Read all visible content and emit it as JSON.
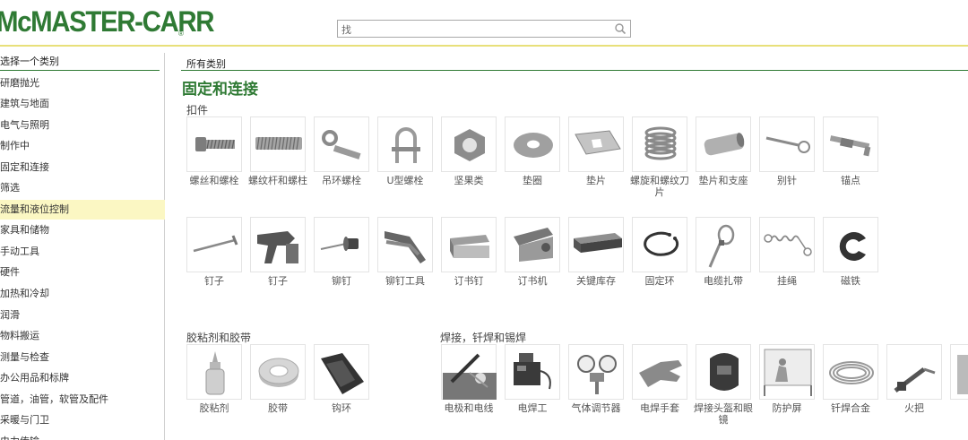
{
  "header": {
    "logo_text": "McMASTER-CARR",
    "logo_reg": "®",
    "search_value": "找"
  },
  "sidebar": {
    "title": "选择一个类别",
    "items": [
      {
        "label": "研磨抛光"
      },
      {
        "label": "建筑与地面"
      },
      {
        "label": "电气与照明"
      },
      {
        "label": "制作中"
      },
      {
        "label": "固定和连接"
      },
      {
        "label": "筛选"
      },
      {
        "label": "流量和液位控制",
        "active": true
      },
      {
        "label": "家具和储物"
      },
      {
        "label": "手动工具"
      },
      {
        "label": "硬件"
      },
      {
        "label": "加热和冷却"
      },
      {
        "label": "润滑"
      },
      {
        "label": "物料搬运"
      },
      {
        "label": "测量与检查"
      },
      {
        "label": "办公用品和标牌"
      },
      {
        "label": "管道，油管，软管及配件"
      },
      {
        "label": "采暖与门卫"
      },
      {
        "label": "电力传输"
      }
    ]
  },
  "main": {
    "breadcrumb": "所有类别",
    "title": "固定和连接",
    "sections": {
      "fasteners": {
        "title": "扣件",
        "tiles": [
          {
            "label": "螺丝和螺栓",
            "icon": "screw-icon"
          },
          {
            "label": "螺纹杆和螺柱",
            "icon": "threaded-rod-icon"
          },
          {
            "label": "吊环螺栓",
            "icon": "eye-bolt-icon"
          },
          {
            "label": "U型螺栓",
            "icon": "u-bolt-icon"
          },
          {
            "label": "坚果类",
            "icon": "hex-nut-icon"
          },
          {
            "label": "垫圈",
            "icon": "washer-icon"
          },
          {
            "label": "垫片",
            "icon": "shim-icon"
          },
          {
            "label": "螺旋和螺纹刀片",
            "icon": "helical-insert-icon"
          },
          {
            "label": "垫片和支座",
            "icon": "spacer-icon"
          },
          {
            "label": "别针",
            "icon": "pin-icon"
          },
          {
            "label": "锚点",
            "icon": "anchor-icon"
          },
          {
            "label": "钉子",
            "icon": "nail-icon"
          },
          {
            "label": "钉子",
            "icon": "nail-gun-icon"
          },
          {
            "label": "铆钉",
            "icon": "rivet-icon"
          },
          {
            "label": "铆钉工具",
            "icon": "rivet-tool-icon"
          },
          {
            "label": "订书钉",
            "icon": "staples-icon"
          },
          {
            "label": "订书机",
            "icon": "stapler-icon"
          },
          {
            "label": "关键库存",
            "icon": "key-stock-icon"
          },
          {
            "label": "固定环",
            "icon": "retaining-ring-icon"
          },
          {
            "label": "电缆扎带",
            "icon": "cable-tie-icon"
          },
          {
            "label": "挂绳",
            "icon": "lanyard-icon"
          },
          {
            "label": "磁铁",
            "icon": "magnet-icon"
          }
        ]
      },
      "adhesives": {
        "title": "胶粘剂和胶带",
        "tiles": [
          {
            "label": "胶粘剂",
            "icon": "glue-bottle-icon"
          },
          {
            "label": "胶带",
            "icon": "tape-roll-icon"
          },
          {
            "label": "钩环",
            "icon": "hook-loop-icon"
          }
        ]
      },
      "welding": {
        "title": "焊接，钎焊和锡焊",
        "tiles": [
          {
            "label": "电极和电线",
            "icon": "electrode-icon"
          },
          {
            "label": "电焊工",
            "icon": "welder-machine-icon"
          },
          {
            "label": "气体调节器",
            "icon": "gas-regulator-icon"
          },
          {
            "label": "电焊手套",
            "icon": "welding-glove-icon"
          },
          {
            "label": "焊接头盔和眼镜",
            "icon": "welding-helmet-icon"
          },
          {
            "label": "防护屏",
            "icon": "protective-screen-icon"
          },
          {
            "label": "钎焊合金",
            "icon": "brazing-alloy-icon"
          },
          {
            "label": "火把",
            "icon": "torch-icon"
          }
        ]
      }
    }
  }
}
